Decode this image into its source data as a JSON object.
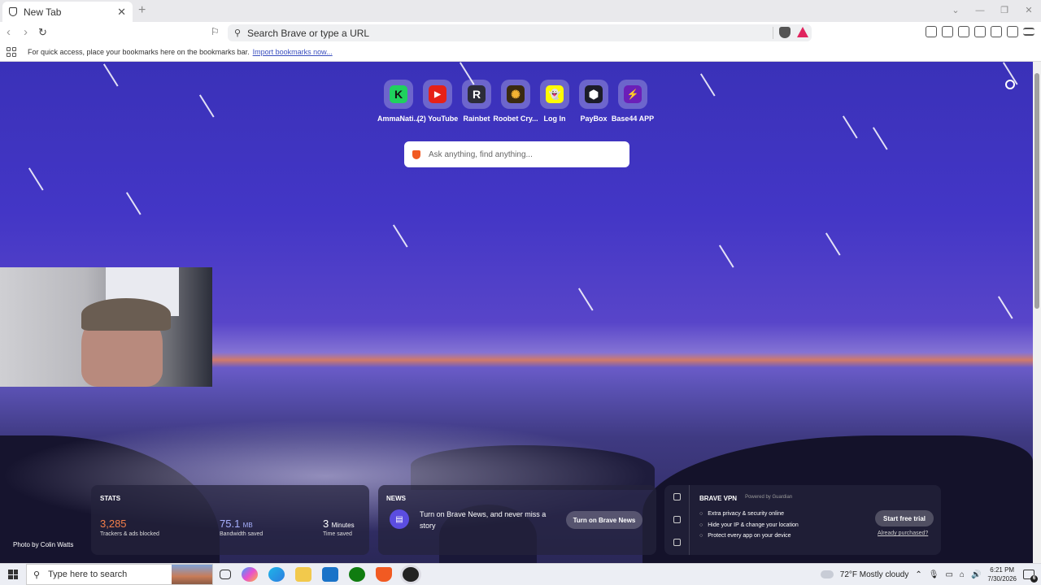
{
  "tab": {
    "title": "New Tab"
  },
  "toolbar": {
    "address_placeholder": "Search Brave or type a URL"
  },
  "bookmarks_bar": {
    "message": "For quick access, place your bookmarks here on the bookmarks bar.",
    "import_link": "Import bookmarks now..."
  },
  "top_sites": [
    {
      "label": "AmmaNati...",
      "glyph": "K",
      "color": "#1fd15e"
    },
    {
      "label": "(2) YouTube",
      "glyph": "▶",
      "color": "#e62117"
    },
    {
      "label": "Rainbet",
      "glyph": "R",
      "color": "#2c2c38"
    },
    {
      "label": "Roobet Cry...",
      "glyph": "✺",
      "color": "#3a2a10"
    },
    {
      "label": "Log In",
      "glyph": "👻",
      "color": "#fffc00"
    },
    {
      "label": "PayBox",
      "glyph": "⬢",
      "color": "#1c1c28"
    },
    {
      "label": "Base44 APP",
      "glyph": "⚡",
      "color": "#6b1fb8"
    }
  ],
  "search": {
    "placeholder": "Ask anything, find anything..."
  },
  "photo_credit": "Photo by Colin Watts",
  "stats": {
    "heading": "STATS",
    "trackers": {
      "value": "3,285",
      "label": "Trackers & ads blocked"
    },
    "bandwidth": {
      "value": "75.1",
      "unit": "MB",
      "label": "Bandwidth saved"
    },
    "time": {
      "value": "3",
      "unit": "Minutes",
      "label": "Time saved"
    }
  },
  "news": {
    "heading": "NEWS",
    "text": "Turn on Brave News, and never miss a story",
    "button": "Turn on Brave News"
  },
  "vpn": {
    "heading": "BRAVE VPN",
    "powered": "Powered by Guardian",
    "features": [
      "Extra privacy & security online",
      "Hide your IP & change your location",
      "Protect every app on your device"
    ],
    "button": "Start free trial",
    "link": "Already purchased?"
  },
  "taskbar": {
    "search_placeholder": "Type here to search",
    "weather": "72°F  Mostly cloudy",
    "time": "6:21 PM",
    "date": "7/30/2026",
    "notification_count": "6"
  },
  "colors": {
    "accent_orange": "#f15a22",
    "bat_red": "#e0245e",
    "stat_trackers": "#f47f4a",
    "stat_bandwidth": "#a8b1ff"
  }
}
